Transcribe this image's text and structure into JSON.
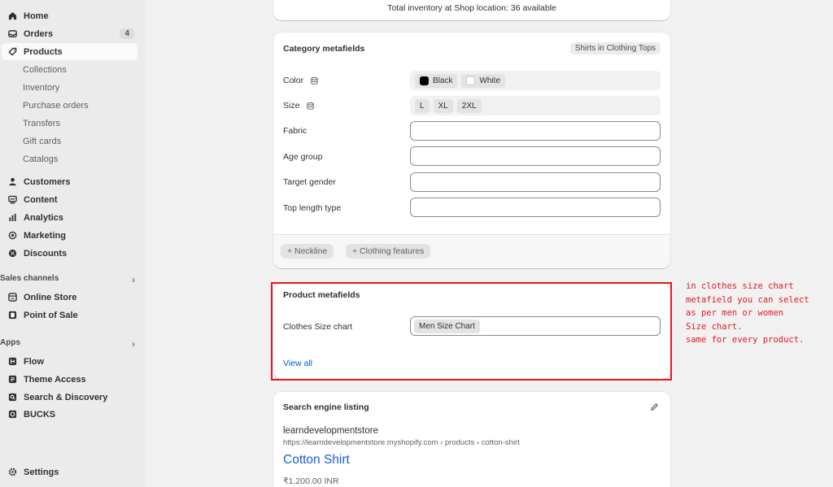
{
  "sidebar": {
    "home": "Home",
    "orders": "Orders",
    "orders_count": "4",
    "products": "Products",
    "sub": [
      "Collections",
      "Inventory",
      "Purchase orders",
      "Transfers",
      "Gift cards",
      "Catalogs"
    ],
    "customers": "Customers",
    "content": "Content",
    "analytics": "Analytics",
    "marketing": "Marketing",
    "discounts": "Discounts",
    "sales_channels": "Sales channels",
    "online_store": "Online Store",
    "point_of_sale": "Point of Sale",
    "apps": "Apps",
    "flow": "Flow",
    "theme_access": "Theme Access",
    "search_discovery": "Search & Discovery",
    "bucks": "BUCKS",
    "settings": "Settings"
  },
  "inventory": {
    "text": "Total inventory at Shop location: 36 available"
  },
  "category_metafields": {
    "title": "Category metafields",
    "category_tag": "Shirts in Clothing Tops",
    "color_label": "Color",
    "colors": [
      "Black",
      "White"
    ],
    "color_swatches": [
      "#000000",
      "#ffffff"
    ],
    "size_label": "Size",
    "sizes": [
      "L",
      "XL",
      "2XL"
    ],
    "fabric_label": "Fabric",
    "age_group_label": "Age group",
    "target_gender_label": "Target gender",
    "top_length_label": "Top length type",
    "add_neckline": "+ Neckline",
    "add_clothing_features": "+ Clothing features"
  },
  "product_metafields": {
    "title": "Product metafields",
    "size_chart_label": "Clothes Size chart",
    "size_chart_value": "Men Size Chart",
    "view_all": "View all"
  },
  "annotation": {
    "text": "in clothes size chart\nmetafield you can select\nas per men or women\nSize chart.\nsame for every product."
  },
  "seo": {
    "title": "Search engine listing",
    "store_name": "learndevelopmentstore",
    "url": "https://learndevelopmentstore.myshopify.com › products › cotton-shirt",
    "page_title": "Cotton Shirt",
    "price": "₹1,200.00 INR"
  },
  "colors": {
    "accent_link": "#005bd3",
    "annotation_red": "#e01b24"
  }
}
